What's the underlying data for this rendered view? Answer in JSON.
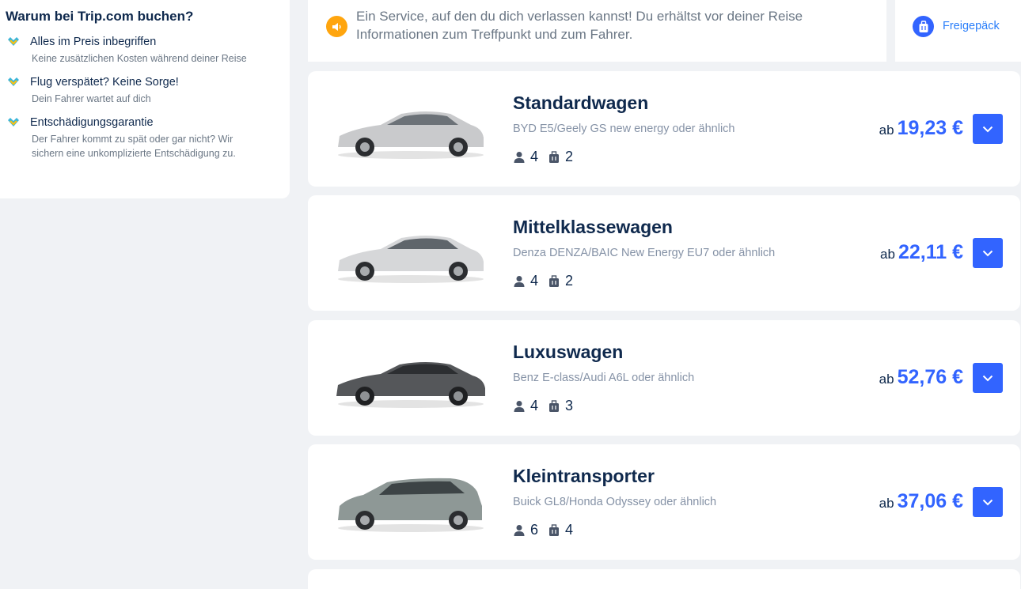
{
  "sidebar": {
    "title": "Warum bei Trip.com buchen?",
    "features": [
      {
        "title": "Alles im Preis inbegriffen",
        "desc": "Keine zusätzlichen Kosten während deiner Reise"
      },
      {
        "title": "Flug verspätet? Keine Sorge!",
        "desc": "Dein Fahrer wartet auf dich"
      },
      {
        "title": "Entschädigungsgarantie",
        "desc": "Der Fahrer kommt zu spät oder gar nicht? Wir sichern eine unkomplizierte Entschädigung zu."
      }
    ]
  },
  "notice": {
    "text": "Ein Service, auf den du dich verlassen kannst! Du erhältst vor deiner Reise Informationen zum Treffpunkt und zum Fahrer.",
    "icon": "speaker-icon"
  },
  "luggage": {
    "label": "Freigepäck",
    "icon": "suitcase-icon"
  },
  "cars": [
    {
      "name": "Standardwagen",
      "models": "BYD E5/Geely GS new energy oder ähnlich",
      "passengers": "4",
      "bags": "2",
      "price_prefix": "ab",
      "price": "19,23 €",
      "color": "#c9cacc"
    },
    {
      "name": "Mittelklassewagen",
      "models": "Denza DENZA/BAIC New Energy EU7 oder ähnlich",
      "passengers": "4",
      "bags": "2",
      "price_prefix": "ab",
      "price": "22,11 €",
      "color": "#d6d7d9"
    },
    {
      "name": "Luxuswagen",
      "models": "Benz E-class/Audi A6L oder ähnlich",
      "passengers": "4",
      "bags": "3",
      "price_prefix": "ab",
      "price": "52,76 €",
      "color": "#55575a"
    },
    {
      "name": "Kleintransporter",
      "models": "Buick GL8/Honda Odyssey oder ähnlich",
      "passengers": "6",
      "bags": "4",
      "price_prefix": "ab",
      "price": "37,06 €",
      "color": "#8e9896"
    }
  ],
  "colors": {
    "accent": "#3264ff",
    "brand_text": "#0f294d",
    "notice_icon": "#ffa50e"
  }
}
